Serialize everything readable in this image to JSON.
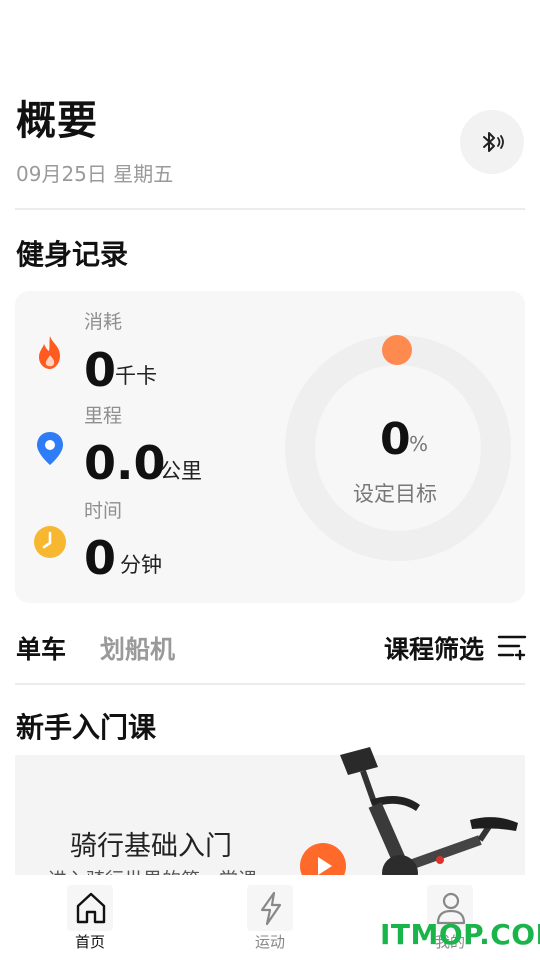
{
  "header": {
    "title": "概要",
    "date": "09月25日 星期五"
  },
  "fitness": {
    "section_title": "健身记录",
    "stats": [
      {
        "label": "消耗",
        "value": "0",
        "unit": "千卡",
        "icon": "flame-icon"
      },
      {
        "label": "里程",
        "value": "0.0",
        "unit": "公里",
        "icon": "location-pin-icon"
      },
      {
        "label": "时间",
        "value": "0",
        "unit": "分钟",
        "icon": "clock-icon"
      }
    ],
    "goal": {
      "value": "0",
      "percent_sign": "%",
      "label": "设定目标",
      "progress": 0
    }
  },
  "tabs": {
    "items": [
      {
        "label": "单车",
        "active": true
      },
      {
        "label": "划船机",
        "active": false
      }
    ],
    "filter_label": "课程筛选"
  },
  "beginner": {
    "section_title": "新手入门课",
    "course": {
      "title": "骑行基础入门",
      "subtitle": "进入骑行世界的第一堂课"
    }
  },
  "bottom_nav": [
    {
      "label": "首页",
      "icon": "home-icon",
      "active": true
    },
    {
      "label": "运动",
      "icon": "lightning-icon",
      "active": false
    },
    {
      "label": "我的",
      "icon": "user-icon",
      "active": false
    }
  ],
  "watermark": "ITMOP.COM",
  "colors": {
    "accent_orange": "#ff6a2b",
    "flame": "#ff5a1f",
    "pin": "#2f7df6",
    "clock": "#f7b731",
    "watermark_green": "#19b44a"
  }
}
